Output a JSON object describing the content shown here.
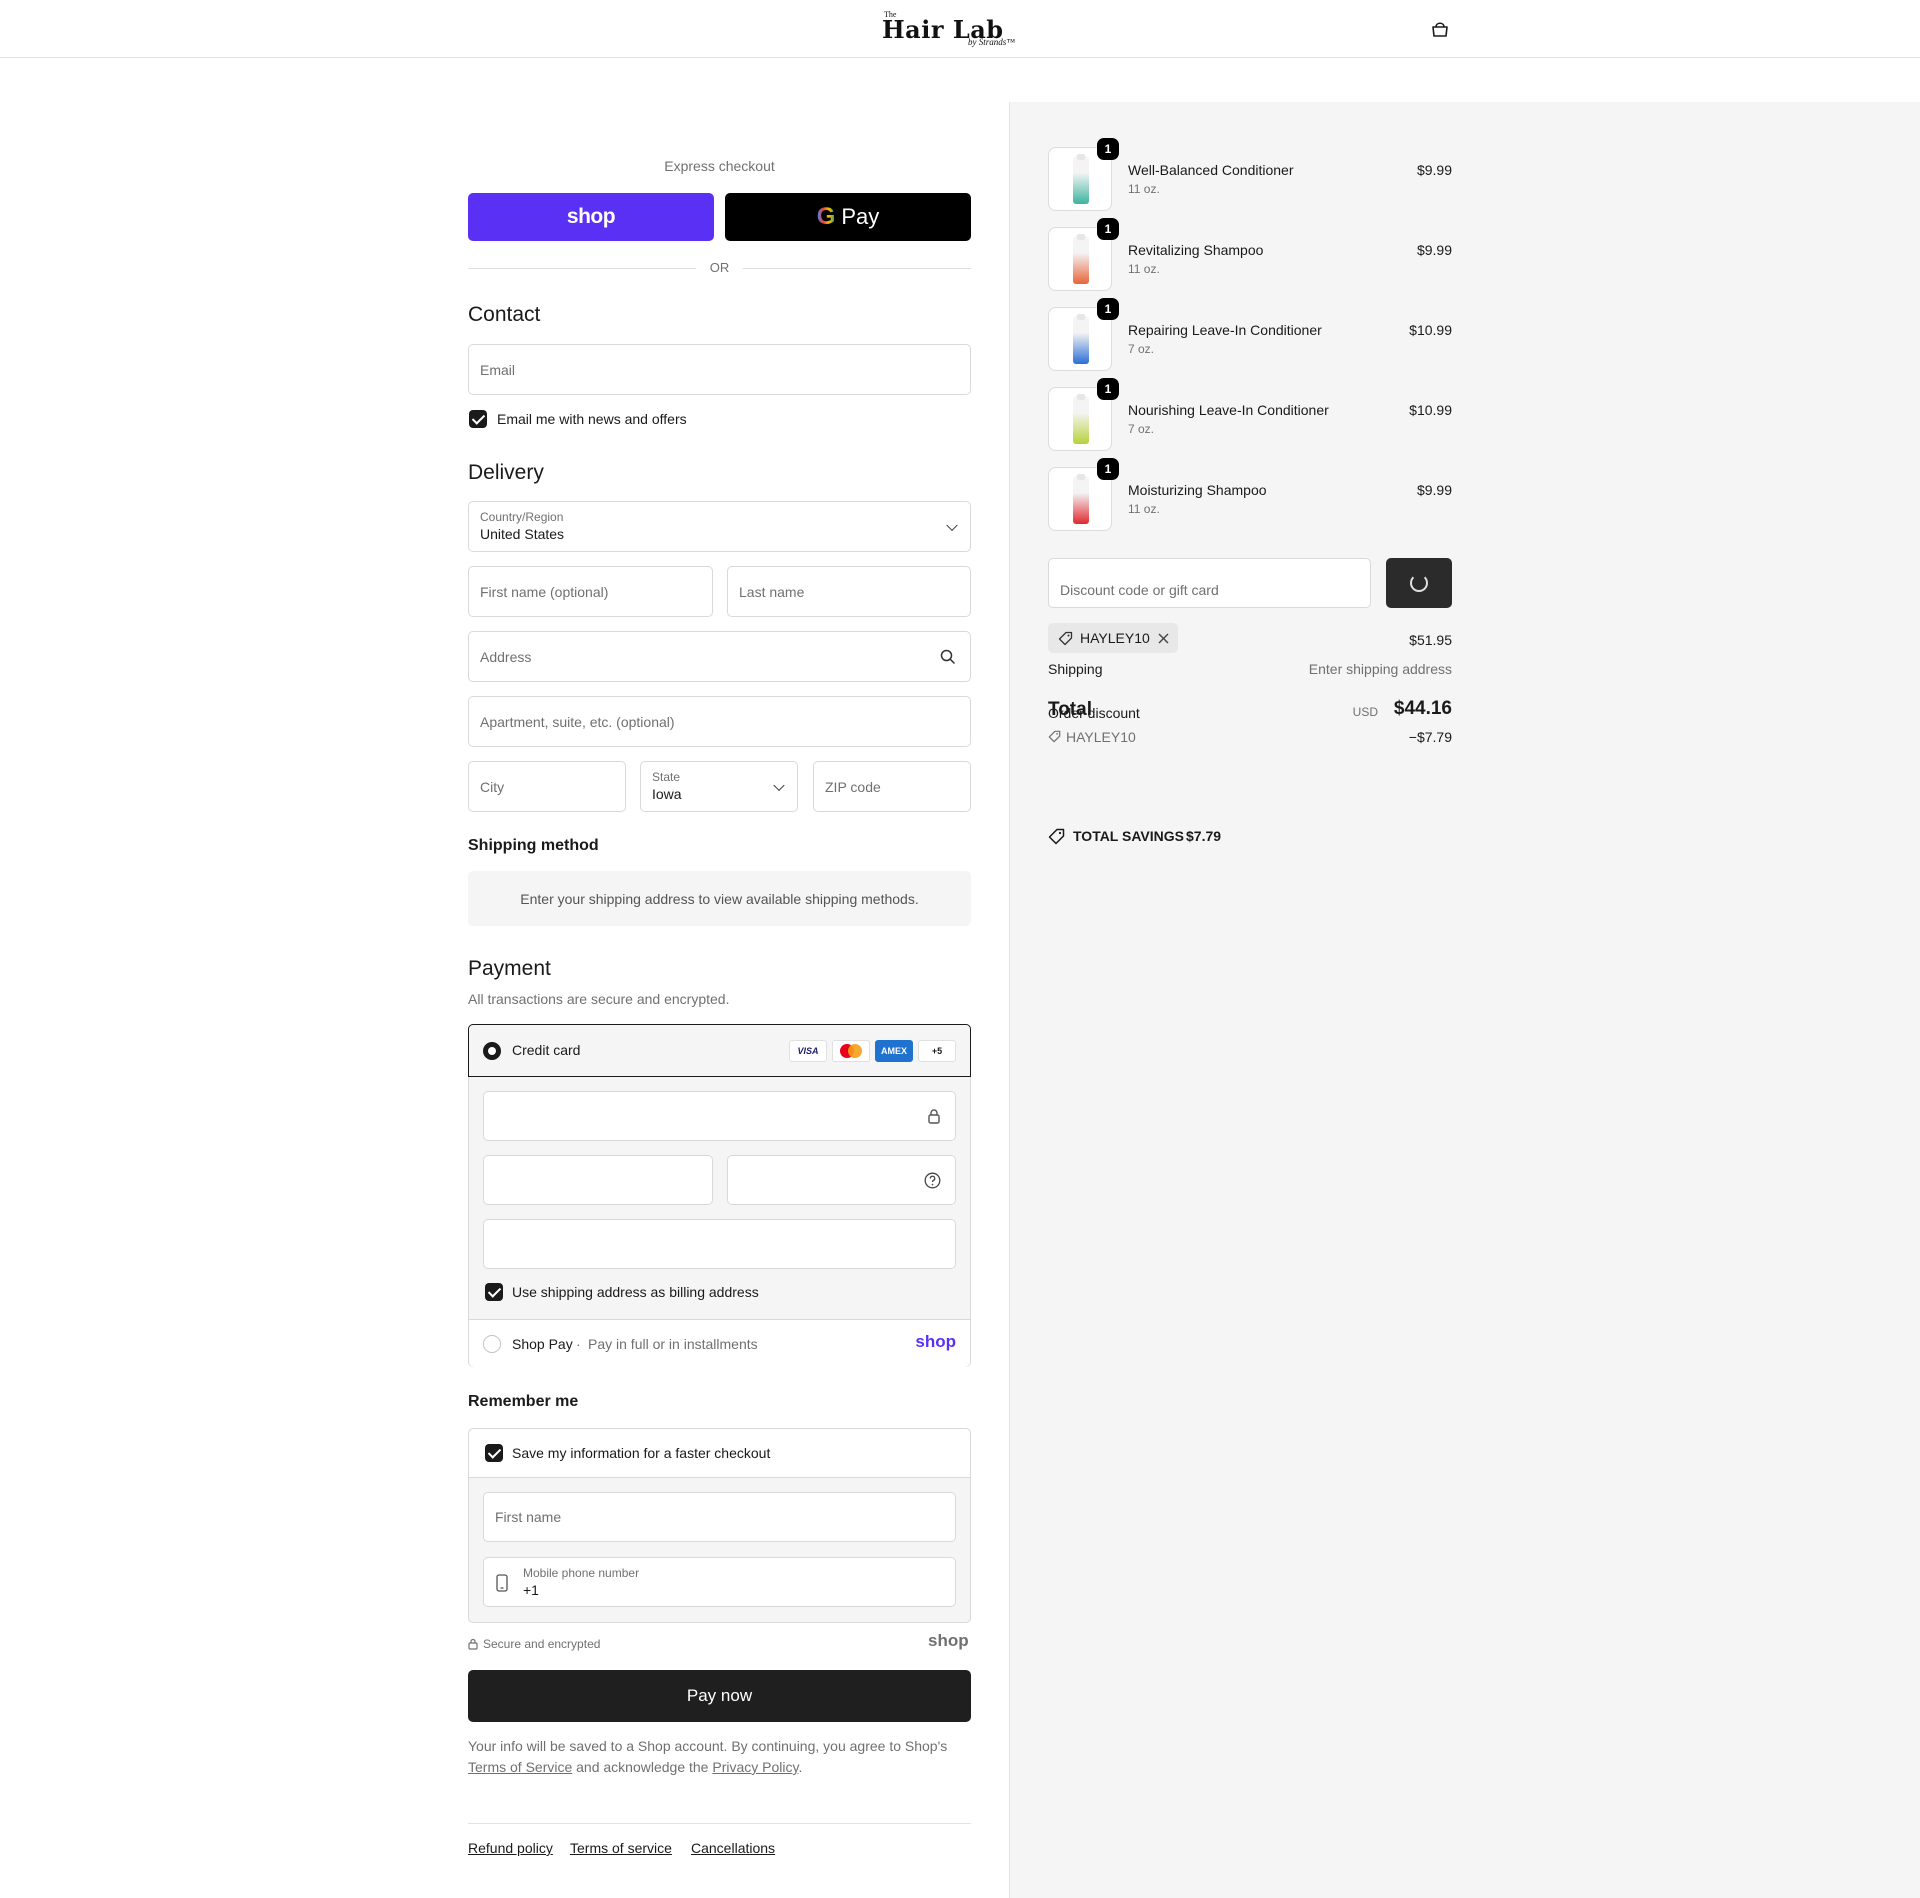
{
  "header": {
    "logo_the": "The",
    "logo_main": "Hair Lab",
    "logo_by": "by Strands™"
  },
  "express": {
    "label": "Express checkout",
    "shop_label": "shop",
    "gpay_g": "G",
    "gpay_label": "Pay",
    "or": "OR"
  },
  "contact": {
    "title": "Contact",
    "email_placeholder": "Email",
    "news_label": "Email me with news and offers"
  },
  "delivery": {
    "title": "Delivery",
    "country_label": "Country/Region",
    "country_value": "United States",
    "first_name_placeholder": "First name (optional)",
    "last_name_placeholder": "Last name",
    "address_placeholder": "Address",
    "apartment_placeholder": "Apartment, suite, etc. (optional)",
    "city_placeholder": "City",
    "state_label": "State",
    "state_value": "Iowa",
    "zip_placeholder": "ZIP code"
  },
  "shipping_method": {
    "title": "Shipping method",
    "message": "Enter your shipping address to view available shipping methods."
  },
  "payment": {
    "title": "Payment",
    "subtitle": "All transactions are secure and encrypted.",
    "credit_card_label": "Credit card",
    "card_logos": [
      "VISA",
      "MC",
      "AMEX",
      "+5"
    ],
    "billing_label": "Use shipping address as billing address",
    "shop_pay_label": "Shop Pay",
    "shop_pay_sep": "·",
    "shop_pay_desc": "Pay in full or in installments",
    "shop_pay_logo": "shop"
  },
  "remember": {
    "title": "Remember me",
    "save_label": "Save my information for a faster checkout",
    "first_name_placeholder": "First name",
    "phone_label": "Mobile phone number",
    "phone_value": "+1",
    "secure_label": "Secure and encrypted",
    "shop_logo": "shop"
  },
  "pay_now": "Pay now",
  "legal": {
    "text_1": "Your info will be saved to a Shop account. By continuing, you agree to Shop's",
    "terms_link": "Terms of Service",
    "text_2": "and acknowledge the",
    "privacy_link": "Privacy Policy",
    "text_3": "."
  },
  "footer": {
    "refund": "Refund policy",
    "terms": "Terms of service",
    "cancellations": "Cancellations"
  },
  "cart": {
    "items": [
      {
        "name": "Well-Balanced Conditioner",
        "variant": "11 oz.",
        "price": "$9.99",
        "qty": "1",
        "color": "#3cb4a0"
      },
      {
        "name": "Revitalizing Shampoo",
        "variant": "11 oz.",
        "price": "$9.99",
        "qty": "1",
        "color": "#e8643a"
      },
      {
        "name": "Repairing Leave-In Conditioner",
        "variant": "7 oz.",
        "price": "$10.99",
        "qty": "1",
        "color": "#2a6fd6"
      },
      {
        "name": "Nourishing Leave-In Conditioner",
        "variant": "7 oz.",
        "price": "$10.99",
        "qty": "1",
        "color": "#b6d23a"
      },
      {
        "name": "Moisturizing Shampoo",
        "variant": "11 oz.",
        "price": "$9.99",
        "qty": "1",
        "color": "#e0282e"
      }
    ],
    "discount_placeholder": "Discount code or gift card",
    "applied_code": "HAYLEY10",
    "subtotal": "$51.95",
    "shipping_label": "Shipping",
    "shipping_value": "Enter shipping address",
    "total_label": "Total",
    "order_discount_label": "Order discount",
    "currency": "USD",
    "total_value": "$44.16",
    "discount_code": "HAYLEY10",
    "discount_amount": "−$7.79",
    "savings_label": "TOTAL SAVINGS",
    "savings_value": "$7.79"
  }
}
